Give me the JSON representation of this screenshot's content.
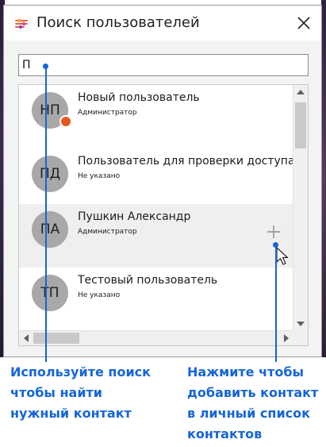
{
  "window": {
    "title": "Поиск пользователей"
  },
  "search": {
    "value": "П"
  },
  "users": [
    {
      "initials": "НП",
      "name": "Новый пользователь",
      "role": "Администратор",
      "online": true
    },
    {
      "initials": "ПД",
      "name": "Пользователь для проверки доступа на",
      "role": "Не указано"
    },
    {
      "initials": "ПА",
      "name": "Пушкин Александр",
      "role": "Администратор",
      "hovered": true
    },
    {
      "initials": "ТП",
      "name": "Тестовый пользователь",
      "role": "Не указано"
    }
  ],
  "annotations": {
    "search_hint": "Используйте поиск\nчтобы найти\nнужный контакт",
    "add_hint": "Нажмите чтобы\nдобавить контакт\nв личный список\nконтактов"
  },
  "colors": {
    "accent": "#1565d8",
    "status_dot": "#e35a1a",
    "avatar": "#a8a8a8",
    "hover_row": "#efefef"
  },
  "icons": {
    "app": "app-logo-icon",
    "close": "close-icon",
    "add": "plus-icon",
    "cursor": "mouse-pointer-icon"
  }
}
